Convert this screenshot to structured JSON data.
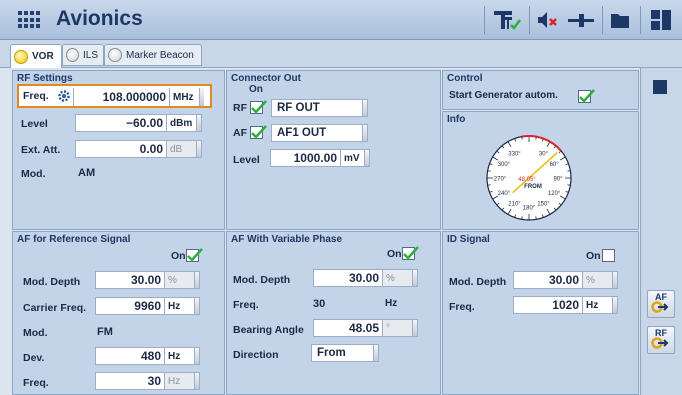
{
  "app": {
    "title": "Avionics"
  },
  "tabs": [
    {
      "label": "VOR",
      "active": true
    },
    {
      "label": "ILS",
      "active": false
    },
    {
      "label": "Marker Beacon",
      "active": false
    }
  ],
  "rf_settings": {
    "title": "RF Settings",
    "freq": {
      "label": "Freq.",
      "value": "108.000000",
      "unit": "MHz"
    },
    "level": {
      "label": "Level",
      "value": "−60.00",
      "unit": "dBm"
    },
    "ext_att": {
      "label": "Ext. Att.",
      "value": "0.00",
      "unit": "dB"
    },
    "mod": {
      "label": "Mod.",
      "value": "AM"
    }
  },
  "connector_out": {
    "title": "Connector Out",
    "on_label": "On",
    "rf": {
      "label": "RF",
      "value": "RF OUT",
      "checked": true
    },
    "af": {
      "label": "AF",
      "value": "AF1 OUT",
      "checked": true
    },
    "level": {
      "label": "Level",
      "value": "1000.00",
      "unit": "mV"
    }
  },
  "control": {
    "title": "Control",
    "start_label": "Start Generator autom.",
    "checked": true
  },
  "info": {
    "title": "Info",
    "compass": {
      "ticks": [
        "0°",
        "30°",
        "60°",
        "90°",
        "120°",
        "150°",
        "180°",
        "210°",
        "240°",
        "270°",
        "300°",
        "330°"
      ],
      "bearing": "48.05°",
      "direction": "FROM"
    }
  },
  "af_reference": {
    "title": "AF for Reference Signal",
    "on_label": "On",
    "checked": true,
    "mod_depth": {
      "label": "Mod. Depth",
      "value": "30.00",
      "unit": "%"
    },
    "carrier_freq": {
      "label": "Carrier Freq.",
      "value": "9960",
      "unit": "Hz"
    },
    "mod": {
      "label": "Mod.",
      "value": "FM"
    },
    "dev": {
      "label": "Dev.",
      "value": "480",
      "unit": "Hz"
    },
    "freq": {
      "label": "Freq.",
      "value": "30",
      "unit": "Hz"
    }
  },
  "af_variable": {
    "title": "AF With Variable Phase",
    "on_label": "On",
    "checked": true,
    "mod_depth": {
      "label": "Mod. Depth",
      "value": "30.00",
      "unit": "%"
    },
    "freq": {
      "label": "Freq.",
      "value": "30",
      "unit": "Hz"
    },
    "bearing": {
      "label": "Bearing Angle",
      "value": "48.05",
      "unit": "°"
    },
    "direction": {
      "label": "Direction",
      "value": "From"
    }
  },
  "id_signal": {
    "title": "ID Signal",
    "on_label": "On",
    "checked": false,
    "mod_depth": {
      "label": "Mod. Depth",
      "value": "30.00",
      "unit": "%"
    },
    "freq": {
      "label": "Freq.",
      "value": "1020",
      "unit": "Hz"
    }
  },
  "sidebar": {
    "af_label": "AF",
    "rf_label": "RF"
  },
  "colors": {
    "accent": "#1d3766",
    "check": "#2fae3a",
    "highlight": "#e08a1e"
  }
}
